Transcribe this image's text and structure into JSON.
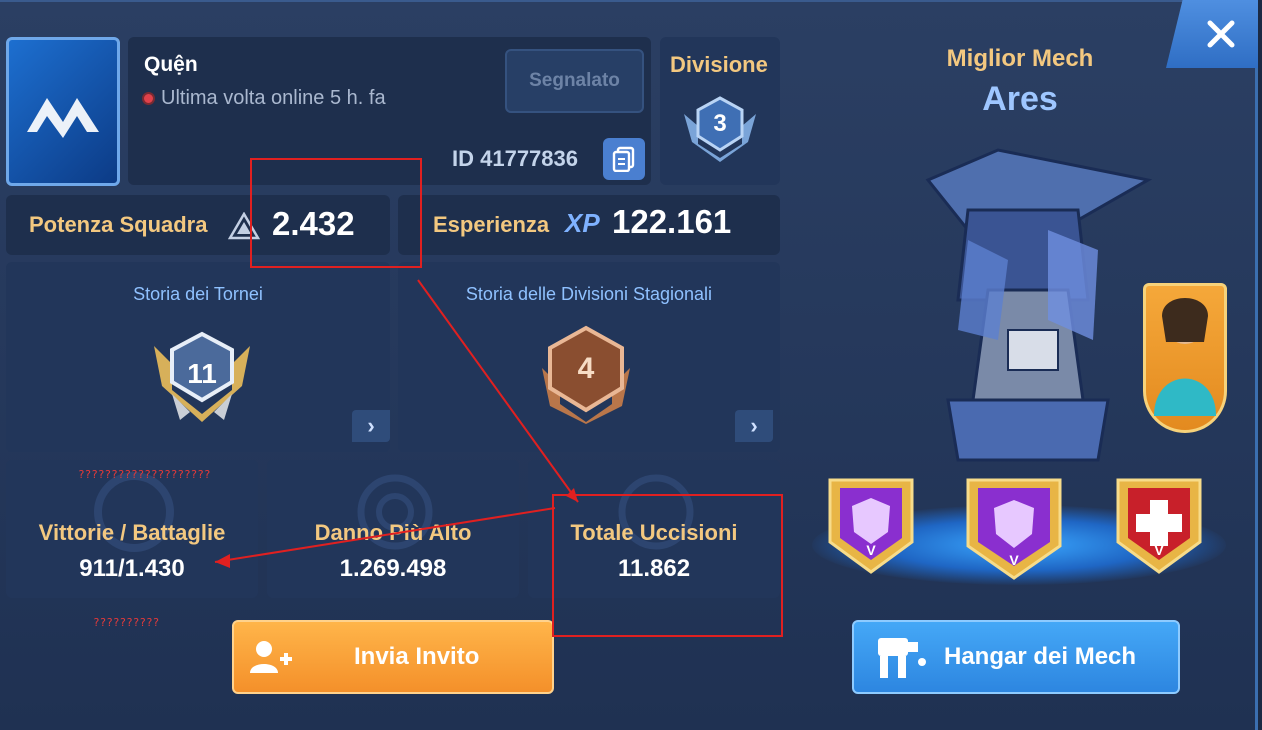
{
  "profile": {
    "name": "Quện",
    "status": "Ultima volta online 5 h.  fa",
    "reported_button": "Segnalato",
    "id_label": "ID 41777836"
  },
  "division": {
    "label": "Divisione",
    "number": "3"
  },
  "stats": {
    "team_power_label": "Potenza Squadra",
    "team_power_value": "2.432",
    "experience_label": "Esperienza",
    "xp_tag": "XP",
    "experience_value": "122.161"
  },
  "history": {
    "tournaments_title": "Storia dei Tornei",
    "tournaments_badge": "11",
    "seasonal_title": "Storia delle Divisioni Stagionali",
    "seasonal_badge": "4"
  },
  "bottom_stats": {
    "wins_label": "Vittorie / Battaglie",
    "wins_value": "911/1.430",
    "damage_label": "Danno Più Alto",
    "damage_value": "1.269.498",
    "kills_label": "Totale Uccisioni",
    "kills_value": "11.862"
  },
  "annotations": {
    "note_top": "????????????????????",
    "note_bottom": "??????????"
  },
  "buttons": {
    "invite": "Invia Invito",
    "hangar": "Hangar dei Mech"
  },
  "best_mech": {
    "title": "Miglior Mech",
    "name": "Ares",
    "module_level": "V"
  },
  "colors": {
    "gold_text": "#f3c880",
    "blue_text": "#8fc1ff",
    "annotation_red": "#e02020",
    "invite_orange": "#f4902a",
    "hangar_blue": "#2d86e0"
  }
}
